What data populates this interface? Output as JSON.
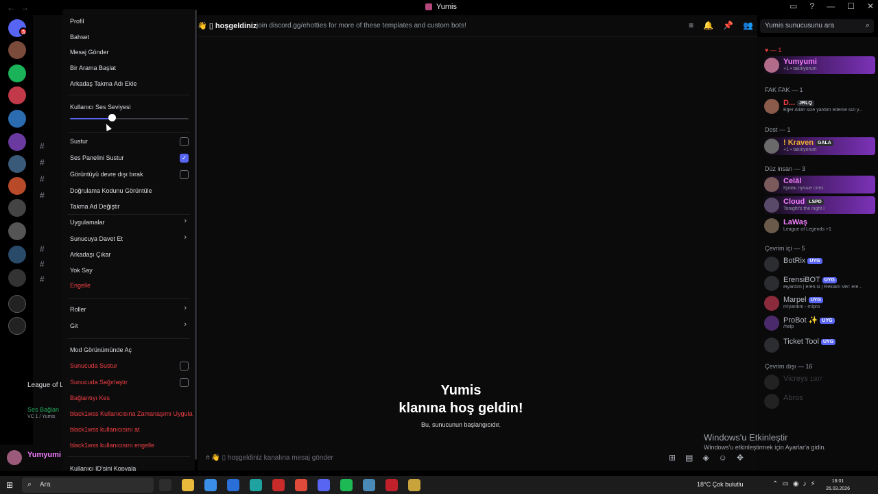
{
  "window": {
    "title": "Yumis",
    "controls": [
      "—",
      "☐",
      "✕"
    ]
  },
  "chat": {
    "channel_name": "👋 ▯ hoşgeldiniz",
    "topic": "join discord.gg/ehotties for more of these templates and custom bots!",
    "welcome_title": "Yumis",
    "welcome_sub": "klanına hoş geldin!",
    "welcome_note": "Bu, sunucunun başlangıcıdır.",
    "message_placeholder": "# 👋 ▯ hoşgeldiniz kanalına mesaj gönder"
  },
  "search": {
    "placeholder": "Yumis sunucusunu ara"
  },
  "context_menu": {
    "items_top": [
      "Profil",
      "Bahset",
      "Mesaj Gönder",
      "Bir Arama Başlat",
      "Arkadaş Takma Adı Ekle"
    ],
    "volume_label": "Kullanıcı Ses Seviyesi",
    "volume_level": 0.35,
    "mute": "Sustur",
    "mute_soundboard": "Ses Panelini Sustur",
    "disable_video": "Görüntüyü devre dışı bırak",
    "verify_code": "Doğrulama Kodunu Görüntüle",
    "change_nick": "Takma Ad Değiştir",
    "apps": "Uygulamalar",
    "invite": "Sunucuya Davet Et",
    "remove_friend": "Arkadaşı Çıkar",
    "ignore": "Yok Say",
    "block": "Engelle",
    "roles": "Roller",
    "go": "Git",
    "mod_view": "Mod Görünümünde Aç",
    "server_mute": "Sunucuda Sustur",
    "server_deafen": "Sunucuda Sağırlaştır",
    "disconnect": "Bağlantıyı Kes",
    "timeout": "black1wss Kullanıcısına Zamanaşımı Uygula",
    "kick": "black1wss kullanıcısını at",
    "ban": "black1wss kullanıcısını engelle",
    "copy_id": "Kullanıcı ID'sini Kopyala"
  },
  "members": {
    "groups": [
      {
        "label": "♥ — 1"
      },
      {
        "label": "FAK FAK — 1"
      },
      {
        "label": "Dost — 1"
      },
      {
        "label": "Düz insan — 3"
      },
      {
        "label": "Çevrim içi — 5"
      },
      {
        "label": "Çevrim dışı — 16"
      }
    ],
    "list": [
      {
        "name": "Yumyumi",
        "status": "+1 • takılıyorum",
        "color": "#f47fff",
        "tag": ""
      },
      {
        "name": "D...",
        "status": "Eğer Allah size yardım ederse sizi y...",
        "color": "#f23f43",
        "tag": "JRLQ"
      },
      {
        "name": "! Kraven",
        "status": "+1 • takılıyorum",
        "color": "#f0b232",
        "tag": "GALA"
      },
      {
        "name": "Celâl",
        "status": "Кровь лучше слез.",
        "color": "#f47fff",
        "tag": ""
      },
      {
        "name": "Cloud",
        "status": "Tonight's the night I",
        "color": "#f47fff",
        "tag": "LSPD"
      },
      {
        "name": "LaWaş",
        "status": "League of Legends +1",
        "color": "#f47fff",
        "tag": ""
      },
      {
        "name": "BotRix",
        "status": "",
        "color": "#b5bac1",
        "tag": "UYG"
      },
      {
        "name": "ErensiBOT",
        "status": "eiyardım | eren.si | Reklam Ver: ere...",
        "color": "#b5bac1",
        "tag": "UYG"
      },
      {
        "name": "Marpel",
        "status": "m!yardım - m!pro",
        "color": "#b5bac1",
        "tag": "UYG"
      },
      {
        "name": "ProBot ✨",
        "status": "/help",
        "color": "#b5bac1",
        "tag": "UYG"
      },
      {
        "name": "Ticket Tool",
        "status": "",
        "color": "#b5bac1",
        "tag": "UYG"
      },
      {
        "name": "Vicreys",
        "status": "",
        "color": "#6d6f78",
        "tag": "1907"
      },
      {
        "name": "Abros",
        "status": "",
        "color": "#6d6f78",
        "tag": ""
      }
    ]
  },
  "watermark": {
    "line1": "Windows'u Etkinleştir",
    "line2": "Windows'u etkinleştirmek için Ayarlar'a gidin."
  },
  "user_panel": {
    "name": "Yumyumi"
  },
  "sidebar": {
    "voice_status": "Ses Bağlan",
    "voice_sub": "VC 1 / Yumis",
    "game": "League of L"
  },
  "taskbar": {
    "search_placeholder": "Ara",
    "weather": "18°C  Çok bulutlu",
    "time": "16:01",
    "date": "26.03.2026"
  }
}
